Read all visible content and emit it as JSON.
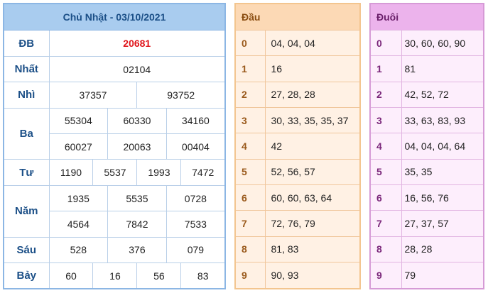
{
  "header": {
    "date_title": "Chủ Nhật - 03/10/2021"
  },
  "prizes": {
    "db": {
      "label": "ĐB",
      "value": "20681"
    },
    "nhat": {
      "label": "Nhất",
      "value": "02104"
    },
    "nhi": {
      "label": "Nhì",
      "values": [
        "37357",
        "93752"
      ]
    },
    "ba": {
      "label": "Ba",
      "values": [
        "55304",
        "60330",
        "34160",
        "60027",
        "20063",
        "00404"
      ]
    },
    "tu": {
      "label": "Tư",
      "values": [
        "1190",
        "5537",
        "1993",
        "7472"
      ]
    },
    "nam": {
      "label": "Năm",
      "values": [
        "1935",
        "5535",
        "0728",
        "4564",
        "7842",
        "7533"
      ]
    },
    "sau": {
      "label": "Sáu",
      "values": [
        "528",
        "376",
        "079"
      ]
    },
    "bay": {
      "label": "Bảy",
      "values": [
        "60",
        "16",
        "56",
        "83"
      ]
    }
  },
  "dau": {
    "title": "Đầu",
    "rows": [
      {
        "k": "0",
        "v": "04, 04, 04"
      },
      {
        "k": "1",
        "v": "16"
      },
      {
        "k": "2",
        "v": "27, 28, 28"
      },
      {
        "k": "3",
        "v": "30, 33, 35, 35, 37"
      },
      {
        "k": "4",
        "v": "42"
      },
      {
        "k": "5",
        "v": "52, 56, 57"
      },
      {
        "k": "6",
        "v": "60, 60, 63, 64"
      },
      {
        "k": "7",
        "v": "72, 76, 79"
      },
      {
        "k": "8",
        "v": "81, 83"
      },
      {
        "k": "9",
        "v": "90, 93"
      }
    ]
  },
  "duoi": {
    "title": "Đuôi",
    "rows": [
      {
        "k": "0",
        "v": "30, 60, 60, 90"
      },
      {
        "k": "1",
        "v": "81"
      },
      {
        "k": "2",
        "v": "42, 52, 72"
      },
      {
        "k": "3",
        "v": "33, 63, 83, 93"
      },
      {
        "k": "4",
        "v": "04, 04, 04, 64"
      },
      {
        "k": "5",
        "v": "35, 35"
      },
      {
        "k": "6",
        "v": "16, 56, 76"
      },
      {
        "k": "7",
        "v": "27, 37, 57"
      },
      {
        "k": "8",
        "v": "28, 28"
      },
      {
        "k": "9",
        "v": "79"
      }
    ]
  },
  "colors": {
    "db_red": "#e0151b",
    "blue_header": "#a9ccef",
    "orange_header": "#fcd9b5",
    "purple_header": "#ecb3ec"
  }
}
